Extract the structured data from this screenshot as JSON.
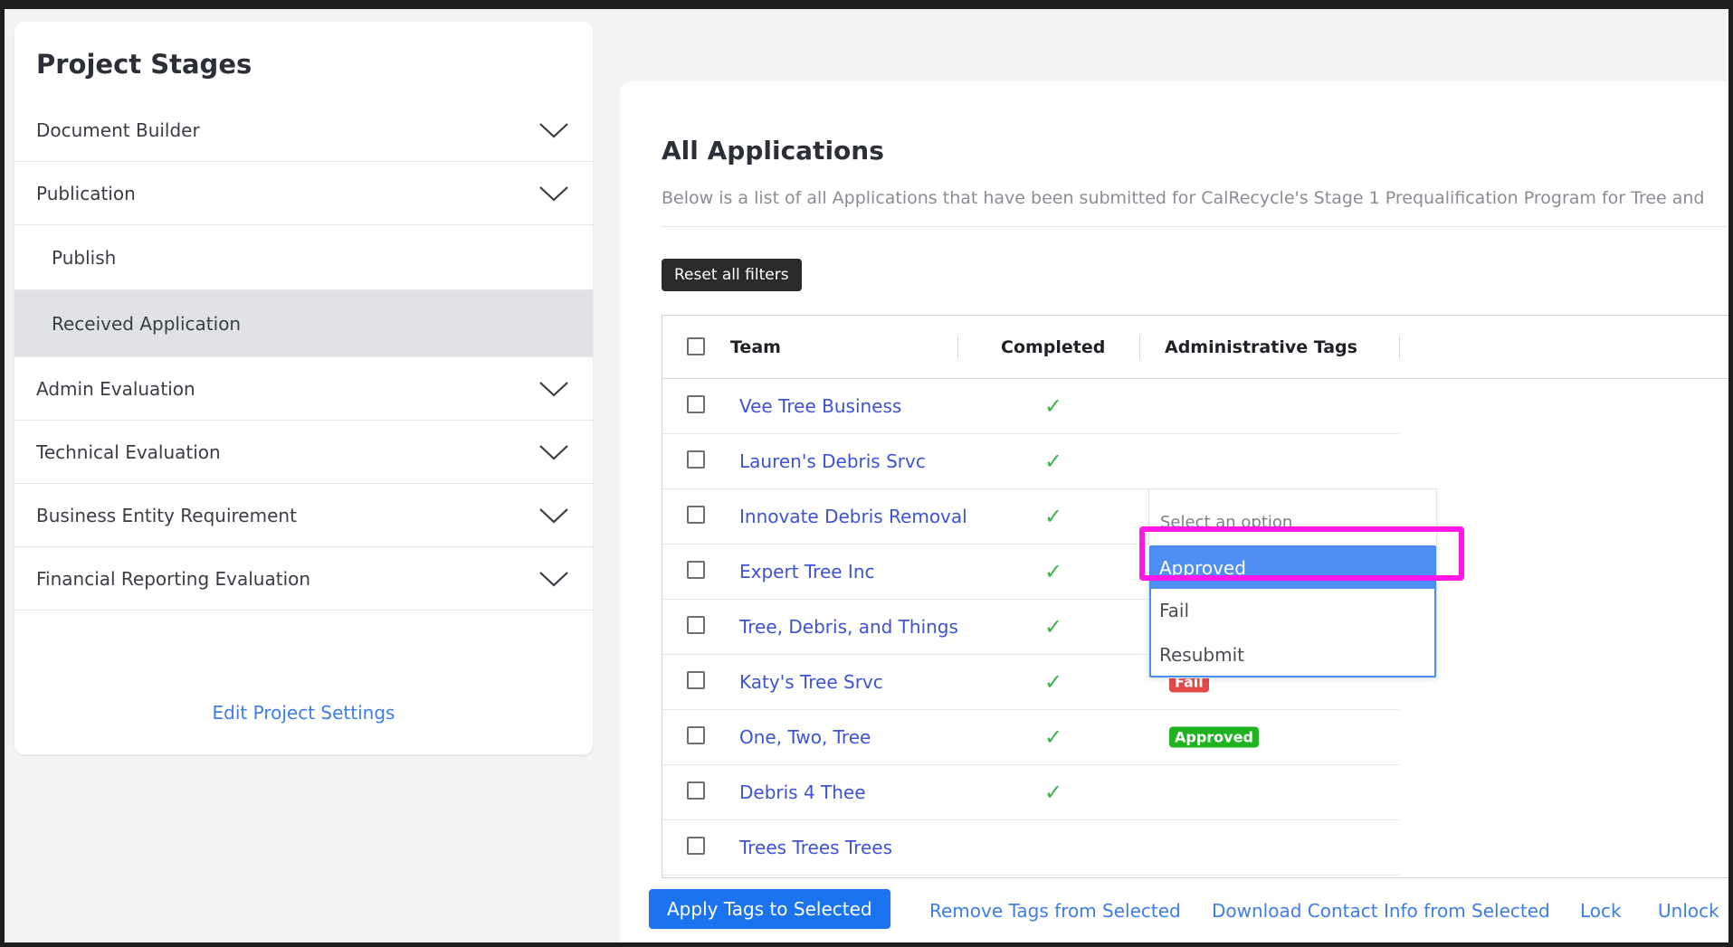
{
  "sidebar": {
    "title": "Project Stages",
    "stages": [
      {
        "label": "Document Builder"
      },
      {
        "label": "Publication"
      },
      {
        "label": "Publish"
      },
      {
        "label": "Received Application"
      },
      {
        "label": "Admin Evaluation"
      },
      {
        "label": "Technical Evaluation"
      },
      {
        "label": "Business Entity Requirement"
      },
      {
        "label": "Financial Reporting Evaluation"
      }
    ],
    "edit_settings": "Edit Project Settings"
  },
  "main": {
    "title": "All Applications",
    "description": "Below is a list of all Applications that have been submitted for CalRecycle's Stage 1 Prequalification Program for Tree and",
    "reset_filters": "Reset all filters",
    "columns": {
      "team": "Team",
      "completed": "Completed",
      "admin_tags": "Administrative Tags"
    },
    "check_glyph": "✓",
    "rows": [
      {
        "team": "Vee Tree Business",
        "completed": true
      },
      {
        "team": "Lauren's Debris Srvc",
        "completed": true
      },
      {
        "team": "Innovate Debris Removal",
        "completed": true
      },
      {
        "team": "Expert Tree Inc",
        "completed": true
      },
      {
        "team": "Tree, Debris, and Things",
        "completed": true
      },
      {
        "team": "Katy's Tree Srvc",
        "completed": true,
        "tag": "Fail"
      },
      {
        "team": "One, Two, Tree",
        "completed": true,
        "tag": "Approved"
      },
      {
        "team": "Debris 4 Thee",
        "completed": true
      },
      {
        "team": "Trees Trees Trees",
        "completed": false
      }
    ]
  },
  "dropdown": {
    "placeholder": "Select an option",
    "options": [
      "Approved",
      "Fail",
      "Resubmit"
    ],
    "active": "Approved"
  },
  "actions": {
    "apply": "Apply Tags to Selected",
    "remove": "Remove Tags from Selected",
    "download": "Download Contact Info from Selected",
    "lock": "Lock",
    "unlock": "Unlock"
  },
  "colors": {
    "tag_fail": "#e24a4a",
    "tag_approved": "#1fb31f",
    "highlight": "#ff17e8",
    "primary": "#1b73f0"
  }
}
